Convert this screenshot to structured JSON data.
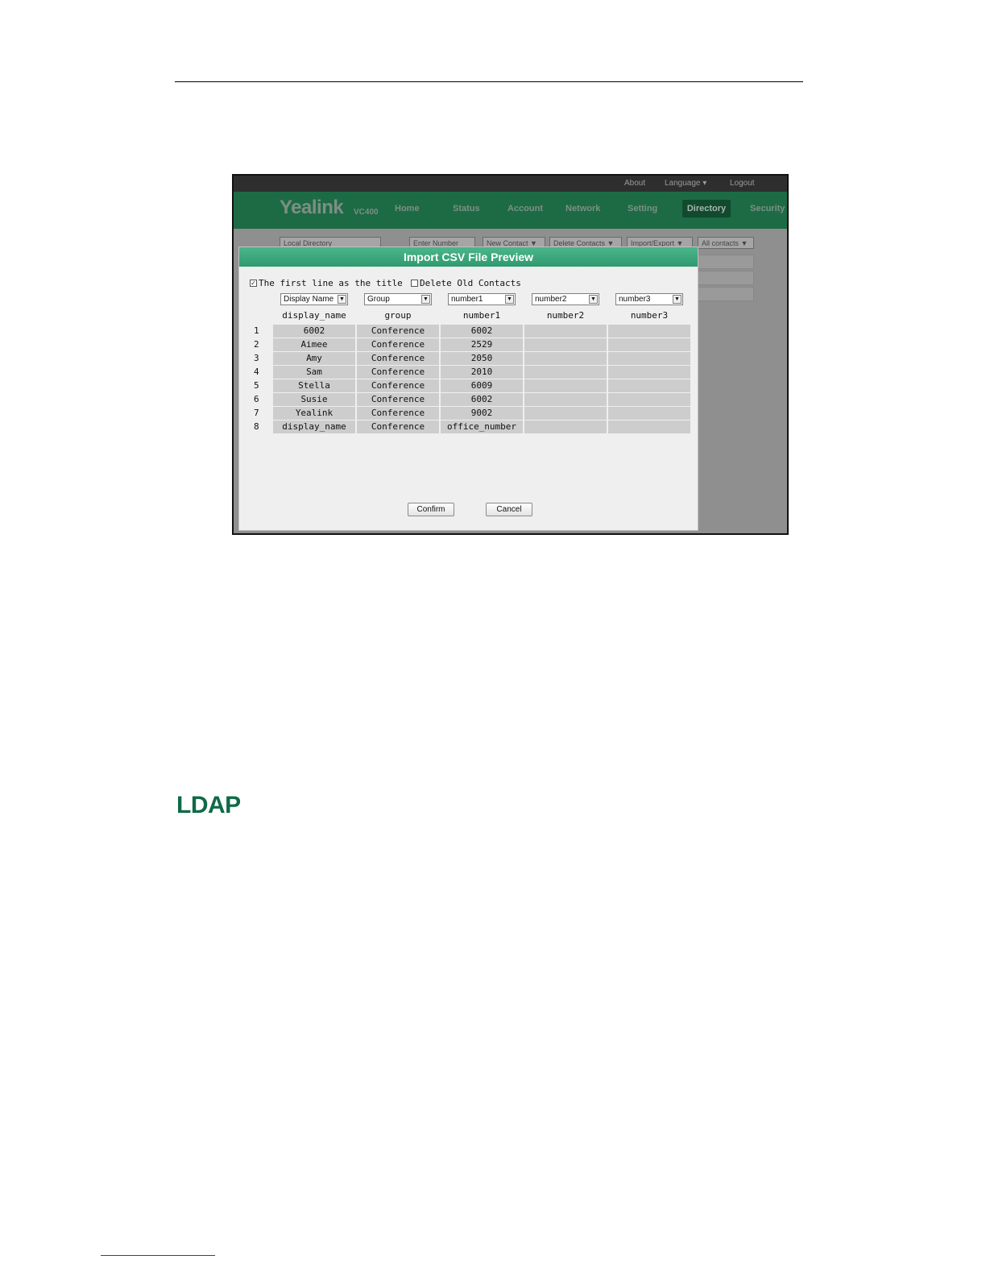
{
  "app_chrome": {
    "top_links": [
      "About",
      "Language ▾",
      "Logout"
    ],
    "brand": "Yealink",
    "brand_model": "VC400",
    "nav": [
      "Home",
      "Status",
      "Account",
      "Network",
      "Setting",
      "Directory",
      "Security"
    ],
    "active_nav": "Directory",
    "toolbar": {
      "local_directory": "Local Directory",
      "search_placeholder": "Enter Number",
      "new_contact": "New Contact ▼",
      "delete_contacts": "Delete Contacts ▼",
      "import_export": "Import/Export ▼",
      "all_contacts": "All contacts ▼"
    }
  },
  "dialog": {
    "title": "Import CSV File Preview",
    "first_line_title": {
      "label": "The first line as the title",
      "checked": true
    },
    "delete_old_contacts": {
      "label": "Delete Old Contacts",
      "checked": false
    },
    "mappings": [
      "Display Name",
      "Group",
      "number1",
      "number2",
      "number3"
    ],
    "columns": [
      "display_name",
      "group",
      "number1",
      "number2",
      "number3"
    ],
    "rows": [
      {
        "n": "1",
        "cells": [
          "6002",
          "Conference",
          "6002",
          "",
          ""
        ]
      },
      {
        "n": "2",
        "cells": [
          "Aimee",
          "Conference",
          "2529",
          "",
          ""
        ]
      },
      {
        "n": "3",
        "cells": [
          "Amy",
          "Conference",
          "2050",
          "",
          ""
        ]
      },
      {
        "n": "4",
        "cells": [
          "Sam",
          "Conference",
          "2010",
          "",
          ""
        ]
      },
      {
        "n": "5",
        "cells": [
          "Stella",
          "Conference",
          "6009",
          "",
          ""
        ]
      },
      {
        "n": "6",
        "cells": [
          "Susie",
          "Conference",
          "6002",
          "",
          ""
        ]
      },
      {
        "n": "7",
        "cells": [
          "Yealink",
          "Conference",
          "9002",
          "",
          ""
        ]
      },
      {
        "n": "8",
        "cells": [
          "display_name",
          "Conference",
          "office_number",
          "",
          ""
        ]
      }
    ],
    "confirm": "Confirm",
    "cancel": "Cancel"
  },
  "document": {
    "section_heading": "LDAP"
  },
  "colors": {
    "dialog_title_bar": "#3aa67c",
    "nav_bar": "#1d6b45",
    "heading": "#0f6a47"
  }
}
